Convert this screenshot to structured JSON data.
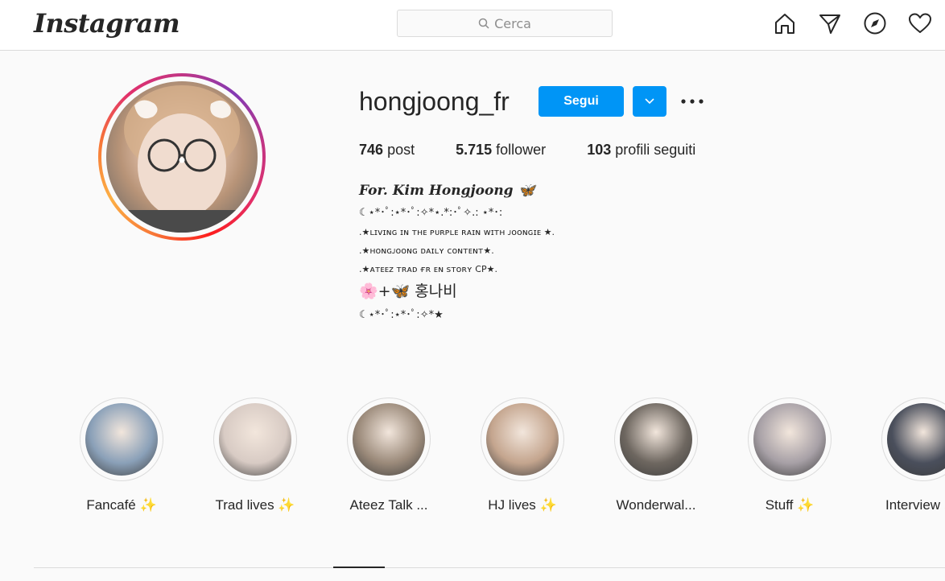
{
  "app": {
    "logo_text": "Instagram"
  },
  "search": {
    "placeholder": "Cerca"
  },
  "nav": {
    "icons": [
      "home-icon",
      "direct-icon",
      "explore-icon",
      "activity-heart-icon"
    ]
  },
  "profile": {
    "username": "hongjoong_fr",
    "follow_label": "Segui",
    "stats": [
      {
        "value": "746",
        "label": "post"
      },
      {
        "value": "5.715",
        "label": "follower"
      },
      {
        "value": "103",
        "label": "profili seguiti"
      }
    ],
    "bio": {
      "title": "For. Kim Hongjoong 🦋",
      "lines": [
        "☾⋆*･ﾟ:⋆*･ﾟ:✧*⋆.*:･ﾟ✧.: ⋆*･:",
        ".★ʟɪᴠɪɴɢ ɪɴ ᴛʜᴇ ᴘᴜʀᴘʟᴇ ʀᴀɪɴ ᴡɪᴛʜ ᴊᴏᴏɴɢɪᴇ ★.",
        ".★ʜᴏɴɢᴊᴏᴏɴɢ ᴅᴀɪʟʏ ᴄᴏɴᴛᴇɴᴛ★.",
        ".★ᴀᴛᴇᴇᴢ ᴛʀᴀᴅ ғʀ ᴇɴ sᴛᴏʀʏ CP★.",
        "🌸+🦋 홍나비",
        "☾⋆*･ﾟ:⋆*･ﾟ:✧*★"
      ]
    }
  },
  "highlights": [
    {
      "label": "Fancafé ✨",
      "color": "#8aa0b8"
    },
    {
      "label": "Trad lives ✨",
      "color": "#d8cbc4"
    },
    {
      "label": "Ateez Talk ...",
      "color": "#9b8a7a"
    },
    {
      "label": "HJ lives ✨",
      "color": "#c4a58e"
    },
    {
      "label": "Wonderwal...",
      "color": "#6e6760"
    },
    {
      "label": "Stuff ✨",
      "color": "#a7a0a6"
    },
    {
      "label": "Interview ✨",
      "color": "#4a4f5c"
    }
  ],
  "colors": {
    "accent": "#0095f6",
    "text": "#262626",
    "border": "#dbdbdb"
  }
}
